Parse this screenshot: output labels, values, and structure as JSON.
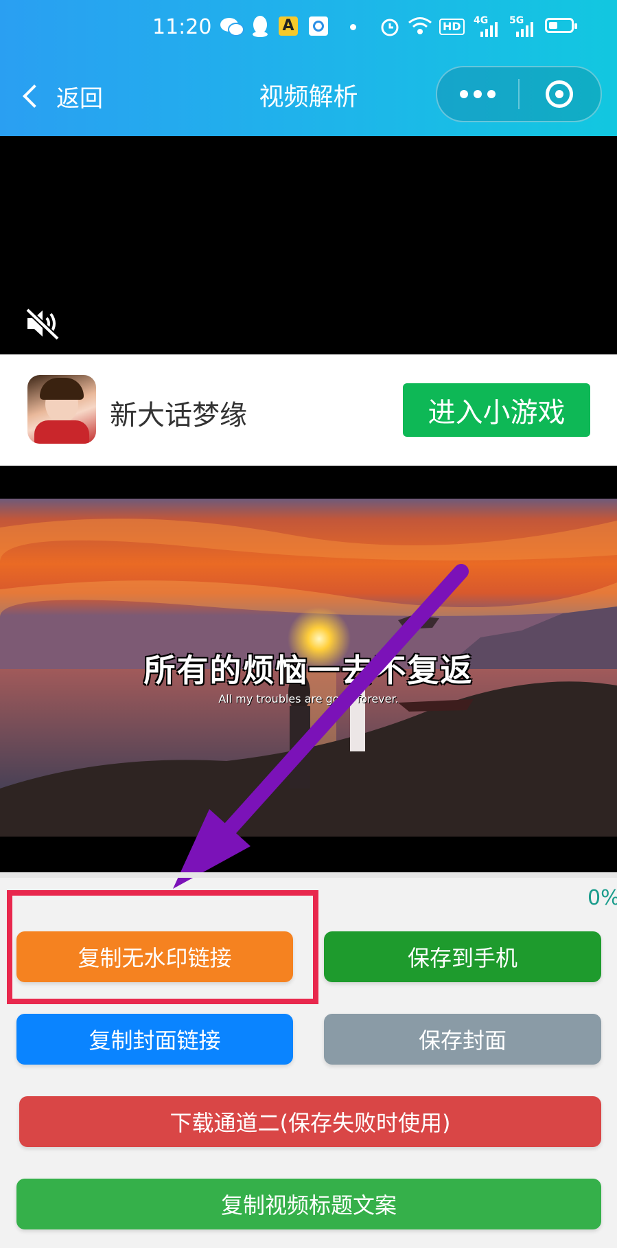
{
  "status_bar": {
    "time": "11:20",
    "battery_icon": "battery-icon",
    "badges": [
      "HD",
      "4G",
      "5G"
    ]
  },
  "nav": {
    "back_label": "返回",
    "title": "视频解析",
    "colors": {
      "gradient_start": "#2a9ff2",
      "gradient_end": "#12c7e0"
    }
  },
  "ad": {
    "game_name": "新大话梦缘",
    "button_label": "进入小游戏",
    "button_color": "#0eb856"
  },
  "preview": {
    "caption_zh": "所有的烦恼一去不复返",
    "caption_en": "All my troubles are gone forever."
  },
  "progress": {
    "value": 0,
    "label": "0%"
  },
  "buttons": {
    "copy_no_watermark": {
      "label": "复制无水印链接",
      "color": "#f58220"
    },
    "save_to_phone": {
      "label": "保存到手机",
      "color": "#1e9b2d"
    },
    "copy_cover_link": {
      "label": "复制封面链接",
      "color": "#0a84ff"
    },
    "save_cover": {
      "label": "保存封面",
      "color": "#8a9ba6"
    },
    "download_channel_two": {
      "label": "下载通道二(保存失败时使用)",
      "color": "#d94646"
    },
    "copy_video_title": {
      "label": "复制视频标题文案",
      "color": "#35b04a"
    }
  },
  "annotation": {
    "arrow_color": "#7b12b8",
    "box_color": "#e8284d"
  }
}
